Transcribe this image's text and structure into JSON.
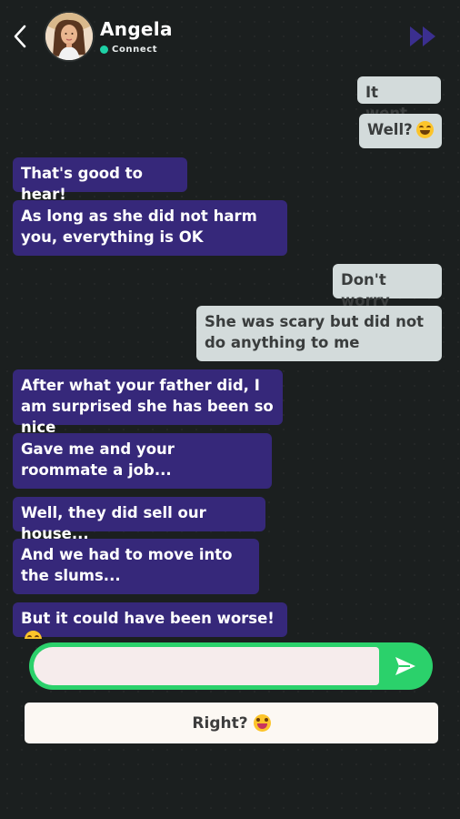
{
  "header": {
    "contact_name": "Angela",
    "status_text": "Connect",
    "status_color": "#1ed1a6",
    "back_icon": "chevron-left-icon",
    "skip_icon": "fast-forward-icon"
  },
  "messages": [
    {
      "side": "out",
      "text": "It went..."
    },
    {
      "side": "out",
      "text": "Well?",
      "emoji": "grinning-sweat"
    },
    {
      "side": "in",
      "text": "That's good to hear!"
    },
    {
      "side": "in",
      "text": "As long as she did not harm you, everything is OK"
    },
    {
      "side": "out",
      "text": "Don't worry"
    },
    {
      "side": "out",
      "text": "She was scary but did not do anything to me"
    },
    {
      "side": "in",
      "text": "After what your father did, I am surprised she has been so nice"
    },
    {
      "side": "in",
      "text": "Gave me and your roommate a job..."
    },
    {
      "side": "in",
      "text": "Well, they did sell our house..."
    },
    {
      "side": "in",
      "text": "And we had to move into the slums..."
    },
    {
      "side": "in",
      "text": "But it could have been worse!",
      "emoji": "grinning-sweat"
    }
  ],
  "composer": {
    "input_value": "",
    "send_icon": "send-arrow-icon"
  },
  "quick_reply": {
    "label": "Right?",
    "emoji": "tears-of-joy"
  },
  "colors": {
    "incoming_bubble": "#36287a",
    "outgoing_bubble": "#d3dbdb",
    "send_accent": "#2bd16b",
    "background": "#1b1f1f"
  }
}
